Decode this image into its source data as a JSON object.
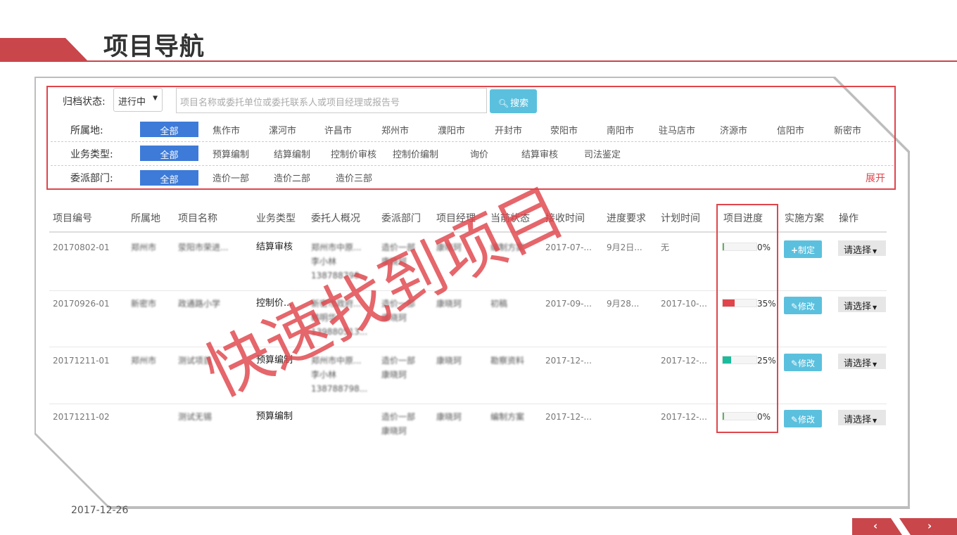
{
  "slide": {
    "title": "项目导航",
    "date": "2017-12-26"
  },
  "filters": {
    "archive_label": "归档状态:",
    "archive_value": "进行中",
    "search_placeholder": "项目名称或委托单位或委托联系人或项目经理或报告号",
    "search_button": "搜索",
    "location_label": "所属地:",
    "locations": [
      "全部",
      "焦作市",
      "漯河市",
      "许昌市",
      "郑州市",
      "濮阳市",
      "开封市",
      "荥阳市",
      "南阳市",
      "驻马店市",
      "济源市",
      "信阳市",
      "新密市"
    ],
    "biz_label": "业务类型:",
    "biz_types": [
      "全部",
      "预算编制",
      "结算编制",
      "控制价审核",
      "控制价编制",
      "询价",
      "结算审核",
      "司法鉴定"
    ],
    "dept_label": "委派部门:",
    "depts": [
      "全部",
      "造价一部",
      "造价二部",
      "造价三部"
    ],
    "expand": "展开"
  },
  "table": {
    "headers": [
      "项目编号",
      "所属地",
      "项目名称",
      "业务类型",
      "委托人概况",
      "委派部门",
      "项目经理",
      "当前状态",
      "接收时间",
      "进度要求",
      "计划时间",
      "项目进度",
      "实施方案",
      "操作"
    ],
    "rows": [
      {
        "id": "20170802-01",
        "loc": "郑州市",
        "name": "荥阳市荣进...",
        "type": "结算审核",
        "client1": "郑州市中原...",
        "client2": "李小林",
        "client3": "138788798...",
        "dept1": "造价一部",
        "dept2": "康晓珂",
        "manager": "康晓珂",
        "status": "编制方案",
        "received": "2017-07-...",
        "req": "9月2日...",
        "plan": "无",
        "progress": 0,
        "progress_text": "0%",
        "progress_color": "#5cb85c",
        "plan_btn": "制定",
        "op": "请选择"
      },
      {
        "id": "20170926-01",
        "loc": "新密市",
        "name": "政通路小学",
        "type": "控制价...",
        "client1": "新密市政府...",
        "client2": "韩明华",
        "client3": "139880513...",
        "dept1": "造价一部",
        "dept2": "康晓珂",
        "manager": "康晓珂",
        "status": "初稿",
        "received": "2017-09-...",
        "req": "9月28...",
        "plan": "2017-10-...",
        "progress": 35,
        "progress_text": "35%",
        "progress_color": "#e0454b",
        "plan_btn": "修改",
        "op": "请选择"
      },
      {
        "id": "20171211-01",
        "loc": "郑州市",
        "name": "测试项目",
        "type": "预算编制",
        "client1": "郑州市中原...",
        "client2": "李小林",
        "client3": "138788798...",
        "dept1": "造价一部",
        "dept2": "康晓珂",
        "manager": "康晓珂",
        "status": "勘察资料",
        "received": "2017-12-...",
        "req": "",
        "plan": "2017-12-...",
        "progress": 25,
        "progress_text": "25%",
        "progress_color": "#1abc9c",
        "plan_btn": "修改",
        "op": "请选择"
      },
      {
        "id": "20171211-02",
        "loc": "",
        "name": "测试无锡",
        "type": "预算编制",
        "client1": "",
        "client2": "",
        "client3": "",
        "dept1": "造价一部",
        "dept2": "康晓珂",
        "manager": "康晓珂",
        "status": "编制方案",
        "received": "2017-12-...",
        "req": "",
        "plan": "2017-12-...",
        "progress": 0,
        "progress_text": "0%",
        "progress_color": "#5cb85c",
        "plan_btn": "修改",
        "op": "请选择"
      }
    ]
  },
  "watermark": "快速找到项目",
  "nav": {
    "prev": "‹",
    "next": "›"
  }
}
